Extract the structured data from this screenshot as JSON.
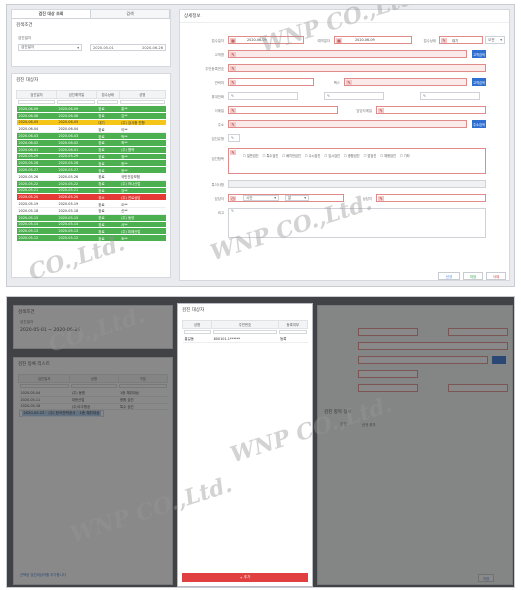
{
  "shot1": {
    "tabs": [
      "검진 대상 조회",
      "검색"
    ],
    "search_title": "검색조건",
    "filter_label": "검진일자",
    "filter_value": "검진일자",
    "date_from": "2020-05-01",
    "date_to": "2020-06-26",
    "list_title": "검진 대상자",
    "columns": [
      "검진일자",
      "검진예약일",
      "접수상태",
      "성명"
    ],
    "rows": [
      {
        "c": "g",
        "v": [
          "2020-06-09",
          "2020-06-09",
          "완료",
          "홍**"
        ]
      },
      {
        "c": "g",
        "v": [
          "2020-06-08",
          "2020-06-08",
          "완료",
          "김**"
        ]
      },
      {
        "c": "y",
        "v": [
          "2020-06-05",
          "2020-06-05",
          "대기",
          "(주) 검사중 진행"
        ]
      },
      {
        "c": "w",
        "v": [
          "2020-06-04",
          "2020-06-04",
          "완료",
          "이**"
        ]
      },
      {
        "c": "g",
        "v": [
          "2020-06-03",
          "2020-06-03",
          "완료",
          "박**"
        ]
      },
      {
        "c": "g",
        "v": [
          "2020-06-02",
          "2020-06-02",
          "완료",
          "최**"
        ]
      },
      {
        "c": "g",
        "v": [
          "2020-06-01",
          "2020-06-01",
          "완료",
          "(주) 협력"
        ]
      },
      {
        "c": "g",
        "v": [
          "2020-05-29",
          "2020-05-29",
          "완료",
          "정**"
        ]
      },
      {
        "c": "g",
        "v": [
          "2020-05-28",
          "2020-05-28",
          "완료",
          "한**"
        ]
      },
      {
        "c": "g",
        "v": [
          "2020-05-27",
          "2020-05-27",
          "완료",
          "윤**"
        ]
      },
      {
        "c": "w",
        "v": [
          "2020-05-26",
          "2020-05-26",
          "완료",
          "국민건강보험"
        ]
      },
      {
        "c": "g",
        "v": [
          "2020-05-22",
          "2020-05-22",
          "완료",
          "(주) 하나산업"
        ]
      },
      {
        "c": "g",
        "v": [
          "2020-05-21",
          "2020-05-21",
          "완료",
          "강**"
        ]
      },
      {
        "c": "r",
        "v": [
          "2020-05-20",
          "2020-05-20",
          "취소",
          "(주) 진료상담"
        ]
      },
      {
        "c": "w",
        "v": [
          "2020-05-19",
          "2020-05-19",
          "완료",
          "오**"
        ]
      },
      {
        "c": "w",
        "v": [
          "2020-05-18",
          "2020-05-18",
          "완료",
          "신**"
        ]
      },
      {
        "c": "g",
        "v": [
          "2020-05-15",
          "2020-05-15",
          "완료",
          "(주) 동양"
        ]
      },
      {
        "c": "g",
        "v": [
          "2020-05-14",
          "2020-05-14",
          "완료",
          "서**"
        ]
      },
      {
        "c": "g",
        "v": [
          "2020-05-13",
          "2020-05-13",
          "완료",
          "(주) 미래산업"
        ]
      },
      {
        "c": "g",
        "v": [
          "2020-05-12",
          "2020-05-12",
          "완료",
          "조**"
        ]
      }
    ],
    "detail_title": "상세정보",
    "field_labels": [
      "접수일자",
      "고객명",
      "주민등록번호",
      "연락처",
      "휴대전화",
      "이메일",
      "주소",
      "검진유형",
      "검진항목",
      "특이사항",
      "담당자",
      "비고"
    ],
    "date_a": "2020-06-09",
    "date_b_label": "예약일자",
    "date_b": "2020-06-09",
    "status_label": "접수상태",
    "status_value": "대기",
    "time_value": "오전",
    "search_btn": "고객검색",
    "addr_btn": "주소검색",
    "phone_label": "팩스",
    "email2_label": "담당자메일",
    "consult_label": "상담자",
    "hour_value": "시간",
    "min_value": "분",
    "checks": [
      "일반검진",
      "특수검진",
      "배치전검진",
      "수시검진",
      "임시검진",
      "종합검진",
      "암검진",
      "채용검진",
      "기타"
    ],
    "btn_new": "신규",
    "btn_save": "저장",
    "btn_delete": "삭제"
  },
  "shot2": {
    "search_title": "검색조건",
    "date_label": "검진일자",
    "date_range": "2020-05-01 ~ 2020-06-26",
    "left_list_title": "검진 등록 리스트",
    "left_columns": [
      "검진일자",
      "성명",
      "구분"
    ],
    "left_rows": [
      {
        "sel": false,
        "v": [
          "2020-05-04",
          "(주) 동원",
          "1종 채취대상"
        ]
      },
      {
        "sel": false,
        "v": [
          "2020-05-11",
          "대한산업",
          "종합 검진"
        ]
      },
      {
        "sel": false,
        "v": [
          "2020-05-18",
          "(주)우주항공",
          "특수 검진"
        ]
      },
      {
        "sel": true,
        "v": [
          "2020-05-25",
          "(주) 한국전력공사",
          "1종 채취대상"
        ]
      }
    ],
    "left_footer": "선택된 검진대상자를 추가합니다",
    "modal_title": "검진 대상자",
    "modal_columns": [
      "성명",
      "주민번호",
      "등록여부"
    ],
    "modal_rows": [
      [
        "홍길동",
        "800101-1******",
        "등록"
      ]
    ],
    "modal_button": "추가",
    "right_section_title": "검진 항목 정보",
    "right_sub_label": "검진",
    "right_sub_value": "신규 추가",
    "right_btn": "저장"
  }
}
